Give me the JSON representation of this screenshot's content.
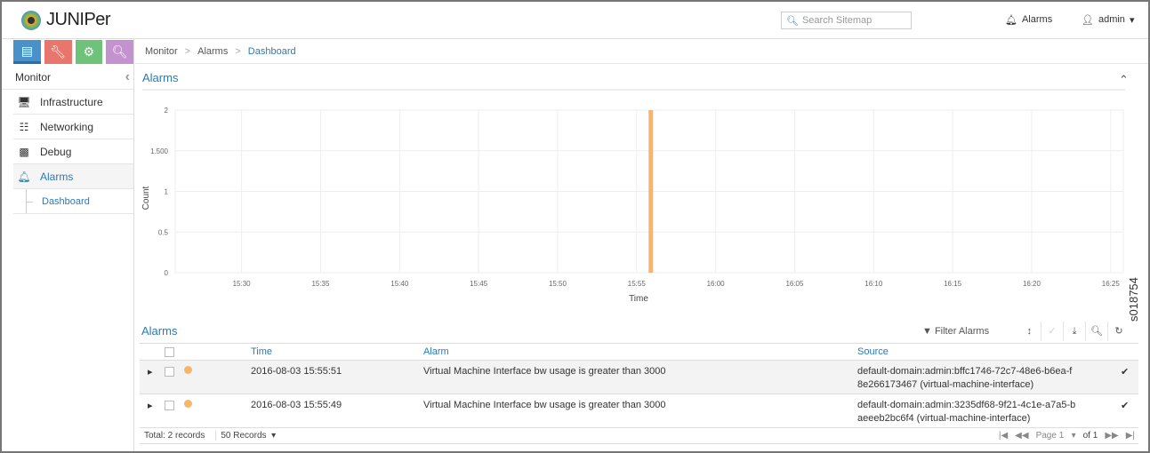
{
  "header": {
    "logo": "JUNIPER NETWORKS",
    "search_placeholder": "Search Sitemap",
    "alarms_label": "Alarms",
    "user_label": "admin"
  },
  "sidebar": {
    "title": "Monitor",
    "items": [
      {
        "label": "Infrastructure",
        "icon": "monitor-icon"
      },
      {
        "label": "Networking",
        "icon": "sitemap-icon"
      },
      {
        "label": "Debug",
        "icon": "puzzle-icon"
      },
      {
        "label": "Alarms",
        "icon": "bell-icon"
      }
    ],
    "subitem": "Dashboard",
    "tab_colors": [
      "#4a90c9",
      "#e8766d",
      "#6fc27a",
      "#c493cf"
    ]
  },
  "breadcrumb": [
    "Monitor",
    "Alarms",
    "Dashboard"
  ],
  "panel": {
    "title": "Alarms"
  },
  "chart_data": {
    "type": "bar",
    "title": "",
    "xlabel": "Time",
    "ylabel": "Count",
    "ylim": [
      0,
      2
    ],
    "yticks": [
      "0",
      "0.5",
      "1",
      "1.500",
      "2"
    ],
    "ytick_values": [
      0,
      0.5,
      1,
      1.5,
      2
    ],
    "xticks": [
      "15:30",
      "15:35",
      "15:40",
      "15:45",
      "15:50",
      "15:55",
      "16:00",
      "16:05",
      "16:10",
      "16:15",
      "16:20",
      "16:25"
    ],
    "xrange_minutes": [
      925.8,
      985.8
    ],
    "bars": [
      {
        "x": "15:55:50",
        "x_minutes": 955.9,
        "value": 2
      }
    ],
    "color": "#f7b56b"
  },
  "watermark": "s018754",
  "grid": {
    "title": "Alarms",
    "filter_label": "Filter Alarms",
    "columns": [
      "Time",
      "Alarm",
      "Source"
    ],
    "rows": [
      {
        "time": "2016-08-03 15:55:51",
        "alarm": "Virtual Machine Interface bw usage is greater than 3000",
        "source1": "default-domain:admin:bffc1746-72c7-48e6-b6ea-f",
        "source2": "8e266173467 (virtual-machine-interface)"
      },
      {
        "time": "2016-08-03 15:55:49",
        "alarm": "Virtual Machine Interface bw usage is greater than 3000",
        "source1": "default-domain:admin:3235df68-9f21-4c1e-a7a5-b",
        "source2": "aeeeb2bc6f4 (virtual-machine-interface)"
      }
    ],
    "total": "Total: 2 records",
    "page_size": "50 Records",
    "page": "Page 1",
    "of": "of 1"
  }
}
